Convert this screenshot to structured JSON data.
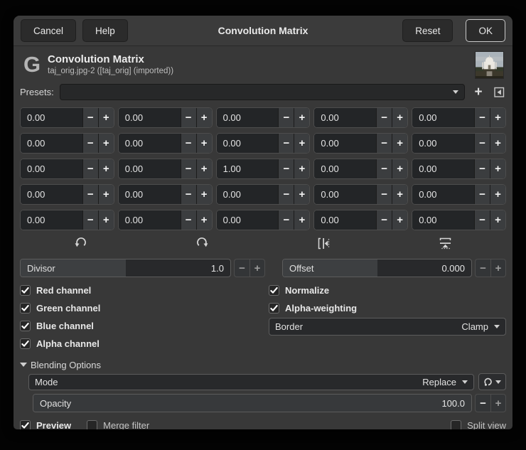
{
  "colors": {
    "window_bg": "#383838",
    "titlebar_bg": "#3b3b3b",
    "entry_bg": "#232527",
    "slider_fill": "#3d3f41",
    "text": "#e6e6e6",
    "focus_border": "#c9c9c9"
  },
  "titlebar": {
    "cancel": "Cancel",
    "help": "Help",
    "title": "Convolution Matrix",
    "reset": "Reset",
    "ok": "OK"
  },
  "header": {
    "logo_glyph": "G",
    "title": "Convolution Matrix",
    "subtitle": "taj_orig.jpg-2 ([taj_orig] (imported))",
    "thumbnail": "taj-mahal-thumbnail"
  },
  "presets": {
    "label": "Presets:",
    "value": "",
    "add_icon": "plus-icon",
    "menu_icon": "import-export-icon"
  },
  "matrix": {
    "rows": [
      [
        "0.00",
        "0.00",
        "0.00",
        "0.00",
        "0.00"
      ],
      [
        "0.00",
        "0.00",
        "0.00",
        "0.00",
        "0.00"
      ],
      [
        "0.00",
        "0.00",
        "1.00",
        "0.00",
        "0.00"
      ],
      [
        "0.00",
        "0.00",
        "0.00",
        "0.00",
        "0.00"
      ],
      [
        "0.00",
        "0.00",
        "0.00",
        "0.00",
        "0.00"
      ]
    ],
    "decrement_glyph": "−",
    "increment_glyph": "+"
  },
  "tools": [
    {
      "name": "rotate-counter-clockwise-icon"
    },
    {
      "name": "rotate-clockwise-icon"
    },
    {
      "name": "flip-horizontal-icon"
    },
    {
      "name": "flip-vertical-icon"
    }
  ],
  "divisor": {
    "label": "Divisor",
    "value": "1.0",
    "decrement_glyph": "−",
    "increment_glyph": "+",
    "fill_percent": 50
  },
  "offset": {
    "label": "Offset",
    "value": "0.000",
    "decrement_glyph": "−",
    "increment_glyph": "+",
    "fill_percent": 50
  },
  "channels": {
    "red": {
      "label": "Red channel",
      "checked": true
    },
    "green": {
      "label": "Green channel",
      "checked": true
    },
    "blue": {
      "label": "Blue channel",
      "checked": true
    },
    "alpha": {
      "label": "Alpha channel",
      "checked": true
    },
    "normalize": {
      "label": "Normalize",
      "checked": true
    },
    "alpha_weighting": {
      "label": "Alpha-weighting",
      "checked": true
    }
  },
  "border": {
    "label": "Border",
    "value": "Clamp"
  },
  "blending": {
    "header": "Blending Options",
    "expanded": true,
    "mode": {
      "label": "Mode",
      "value": "Replace"
    },
    "opacity": {
      "label": "Opacity",
      "value": "100.0",
      "decrement_glyph": "−",
      "increment_glyph": "+",
      "fill_percent": 100
    }
  },
  "footer": {
    "preview": {
      "label": "Preview",
      "checked": true
    },
    "merge_filter": {
      "label": "Merge filter",
      "checked": false
    },
    "split_view": {
      "label": "Split view",
      "checked": false
    }
  }
}
